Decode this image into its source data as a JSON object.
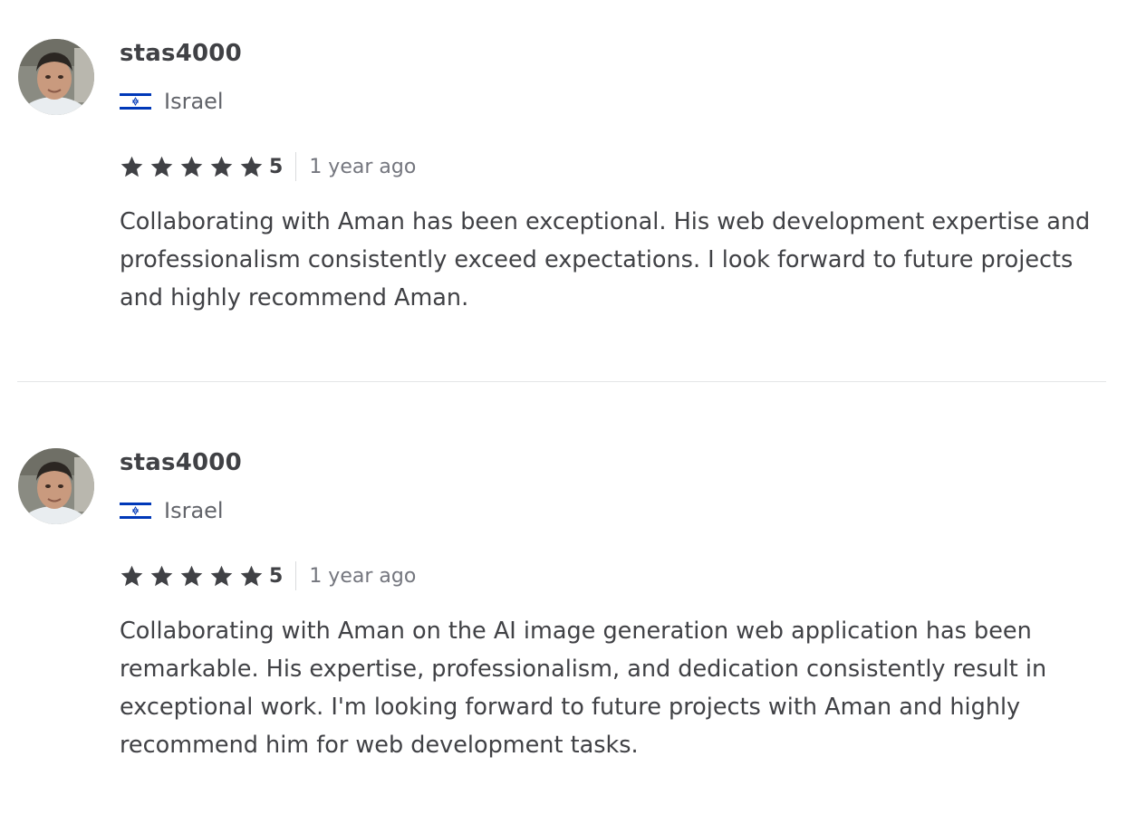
{
  "colors": {
    "text_primary": "#404145",
    "text_secondary": "#62646a",
    "star": "#404145",
    "divider": "#e4e5e7",
    "flag_blue": "#0038b8"
  },
  "reviews": [
    {
      "username": "stas4000",
      "country": "Israel",
      "flag_icon": "israel-flag-icon",
      "rating": "5",
      "rating_value": 5,
      "time": "1 year ago",
      "text": "Collaborating with Aman has been exceptional. His web development expertise and professionalism consistently exceed expectations. I look forward to future projects and highly recommend Aman."
    },
    {
      "username": "stas4000",
      "country": "Israel",
      "flag_icon": "israel-flag-icon",
      "rating": "5",
      "rating_value": 5,
      "time": "1 year ago",
      "text": "Collaborating with Aman on the AI image generation web application has been remarkable. His expertise, professionalism, and dedication consistently result in exceptional work. I'm looking forward to future projects with Aman and highly recommend him for web development tasks."
    }
  ]
}
